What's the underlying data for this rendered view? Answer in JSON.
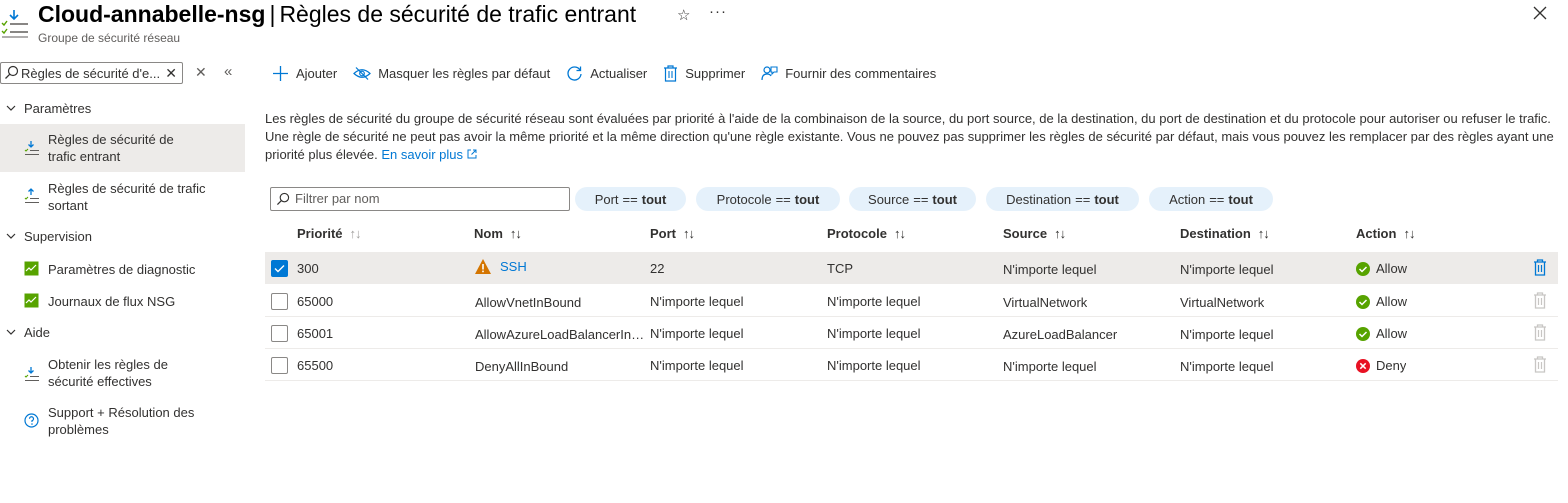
{
  "header": {
    "resource_name": "Cloud-annabelle-nsg",
    "separator": "|",
    "page_title": "Règles de sécurité de trafic entrant",
    "subtitle": "Groupe de sécurité réseau",
    "star_icon": "star-icon",
    "more_icon": "more-icon",
    "more_label": "···",
    "close_icon": "close-icon"
  },
  "sidebar": {
    "search_value": "Règles de sécurité d'e...",
    "groups": [
      {
        "label": "Paramètres",
        "items": [
          {
            "label_line1": "Règles de sécurité de",
            "label_line2": "trafic entrant",
            "icon": "inbound-rules-icon",
            "active": true
          },
          {
            "label_line1": "Règles de sécurité de trafic",
            "label_line2": "sortant",
            "icon": "outbound-rules-icon",
            "active": false
          }
        ]
      },
      {
        "label": "Supervision",
        "items": [
          {
            "label_line1": "Paramètres de diagnostic",
            "icon": "diagnostic-settings-icon"
          },
          {
            "label_line1": "Journaux de flux NSG",
            "icon": "flow-logs-icon"
          }
        ]
      },
      {
        "label": "Aide",
        "items": [
          {
            "label_line1": "Obtenir les règles de",
            "label_line2": "sécurité effectives",
            "icon": "effective-rules-icon"
          },
          {
            "label_line1": "Support + Résolution des",
            "label_line2": "problèmes",
            "icon": "support-icon"
          }
        ]
      }
    ]
  },
  "toolbar": {
    "add_label": "Ajouter",
    "hide_defaults_label": "Masquer les règles par défaut",
    "refresh_label": "Actualiser",
    "delete_label": "Supprimer",
    "feedback_label": "Fournir des commentaires"
  },
  "description": {
    "line1": "Les règles de sécurité du groupe de sécurité réseau sont évaluées par priorité à l'aide de la combinaison de la source, du port source, de la destination, du port de destination et du protocole pour autoriser ou refuser le trafic.",
    "line2": "Une règle de sécurité ne peut pas avoir la même priorité et la même direction qu'une règle existante. Vous ne pouvez pas supprimer les règles de sécurité par défaut, mais vous pouvez les remplacer par des règles ayant une",
    "line3": "priorité plus élevée.",
    "link": "En savoir plus"
  },
  "filters": {
    "search_placeholder": "Filtrer par nom",
    "pills": [
      {
        "field": "Port",
        "op": "==",
        "value": "tout"
      },
      {
        "field": "Protocole",
        "op": "==",
        "value": "tout"
      },
      {
        "field": "Source",
        "op": "==",
        "value": "tout"
      },
      {
        "field": "Destination",
        "op": "==",
        "value": "tout"
      },
      {
        "field": "Action",
        "op": "==",
        "value": "tout"
      }
    ]
  },
  "table": {
    "columns": [
      "Priorité",
      "Nom",
      "Port",
      "Protocole",
      "Source",
      "Destination",
      "Action"
    ],
    "sort_icon": "↑↓",
    "rows": [
      {
        "selected": true,
        "priority": "300",
        "name": "SSH",
        "warning": true,
        "port": "22",
        "protocol": "TCP",
        "source": "N'importe lequel",
        "destination": "N'importe lequel",
        "action": "Allow",
        "action_type": "allow"
      },
      {
        "selected": false,
        "priority": "65000",
        "name": "AllowVnetInBound",
        "warning": false,
        "port": "N'importe lequel",
        "protocol": "N'importe lequel",
        "source": "VirtualNetwork",
        "destination": "VirtualNetwork",
        "action": "Allow",
        "action_type": "allow"
      },
      {
        "selected": false,
        "priority": "65001",
        "name": "AllowAzureLoadBalancerIn…",
        "warning": false,
        "port": "N'importe lequel",
        "protocol": "N'importe lequel",
        "source": "AzureLoadBalancer",
        "destination": "N'importe lequel",
        "action": "Allow",
        "action_type": "allow"
      },
      {
        "selected": false,
        "priority": "65500",
        "name": "DenyAllInBound",
        "warning": false,
        "port": "N'importe lequel",
        "protocol": "N'importe lequel",
        "source": "N'importe lequel",
        "destination": "N'importe lequel",
        "action": "Deny",
        "action_type": "deny"
      }
    ]
  },
  "colors": {
    "accent": "#0078d4",
    "allow": "#57a300",
    "deny": "#e81123",
    "warning": "#d47500",
    "selected_row": "#edebe9",
    "pill_bg": "#e5f1fb"
  }
}
